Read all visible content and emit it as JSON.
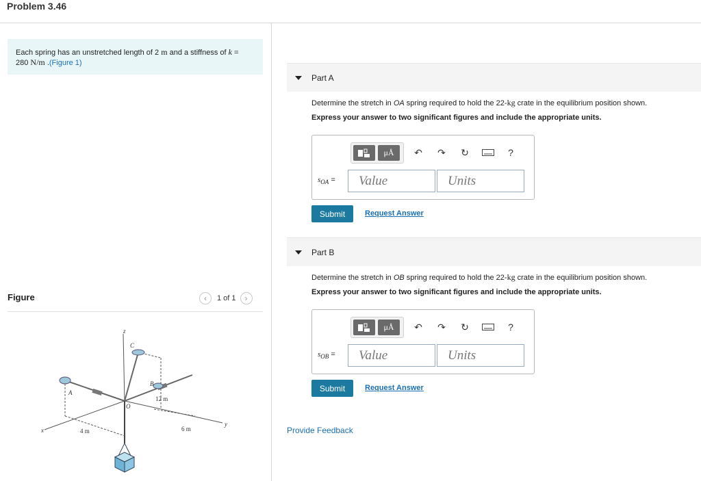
{
  "page": {
    "title": "Problem 3.46"
  },
  "problem": {
    "text_before_length": "Each spring has an unstretched length of 2 ",
    "length_unit": "m",
    "text_before_k": " and a stiffness of ",
    "k_symbol": "k",
    "equals": " =",
    "k_value": "280",
    "k_unit": "N/m",
    "dot": " .",
    "figure_link": "(Figure 1)"
  },
  "figure": {
    "label": "Figure",
    "pager_text": "1 of 1",
    "prev_icon": "chevron-left-icon",
    "next_icon": "chevron-right-icon",
    "labels": {
      "z": "z",
      "c": "C",
      "b": "B",
      "a": "A",
      "o": "O",
      "x": "x",
      "y": "y",
      "dim_12": "12 m",
      "dim_4": "4 m",
      "dim_6": "6 m"
    }
  },
  "parts": [
    {
      "name": "Part A",
      "question_pre": "Determine the stretch in ",
      "spring": "OA",
      "question_mid": " spring required to hold the 22-",
      "mass_unit": "kg",
      "question_post": " crate in the equilibrium position shown.",
      "express": "Express your answer to two significant figures and include the appropriate units.",
      "var_main": "s",
      "var_sub": "OA",
      "equals": " =",
      "value_placeholder": "Value",
      "units_placeholder": "Units",
      "submit_label": "Submit",
      "request_label": "Request Answer"
    },
    {
      "name": "Part B",
      "question_pre": "Determine the stretch in ",
      "spring": "OB",
      "question_mid": " spring required to hold the 22-",
      "mass_unit": "kg",
      "question_post": " crate in the equilibrium position shown.",
      "express": "Express your answer to two significant figures and include the appropriate units.",
      "var_main": "s",
      "var_sub": "OB",
      "equals": " =",
      "value_placeholder": "Value",
      "units_placeholder": "Units",
      "submit_label": "Submit",
      "request_label": "Request Answer"
    }
  ],
  "toolbar": {
    "units_button": "μÅ",
    "help": "?",
    "icons": [
      "templates-icon",
      "units-icon",
      "undo-icon",
      "redo-icon",
      "reset-icon",
      "keyboard-icon",
      "help-icon"
    ]
  },
  "feedback": {
    "label": "Provide Feedback"
  },
  "colors": {
    "accent": "#1c7aa1",
    "link": "#1a6fb3",
    "problem_bg": "#e8f6f7"
  }
}
